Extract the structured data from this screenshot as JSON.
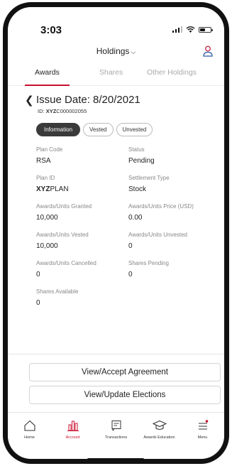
{
  "status_bar": {
    "time": "3:03"
  },
  "header": {
    "title": "Holdings"
  },
  "tabs": [
    {
      "label": "Awards",
      "active": true
    },
    {
      "label": "Shares",
      "active": false
    },
    {
      "label": "Other Holdings",
      "active": false
    }
  ],
  "award": {
    "title": "Issue Date: 8/20/2021",
    "id_label": "ID:",
    "id_bold": "XYZ",
    "id_rest": "C000002055"
  },
  "pills": [
    {
      "label": "Information",
      "selected": true
    },
    {
      "label": "Vested",
      "selected": false
    },
    {
      "label": "Unvested",
      "selected": false
    }
  ],
  "fields": [
    {
      "label": "Plan Code",
      "value": "RSA"
    },
    {
      "label": "Status",
      "value": "Pending"
    },
    {
      "label": "Plan ID",
      "value_bold": "XYZ",
      "value": "PLAN"
    },
    {
      "label": "Settlement Type",
      "value": "Stock"
    },
    {
      "label": "Awards/Units Granted",
      "value": "10,000"
    },
    {
      "label": "Awards/Units Price (USD)",
      "value": "0.00"
    },
    {
      "label": "Awards/Units Vested",
      "value": "10,000"
    },
    {
      "label": "Awards/Units Unvested",
      "value": "0"
    },
    {
      "label": "Awards/Units Cancelled",
      "value": "0"
    },
    {
      "label": "Shares Pending",
      "value": "0"
    },
    {
      "label": "Shares Available",
      "value": "0"
    }
  ],
  "actions": {
    "agreement": "View/Accept Agreement",
    "elections": "View/Update Elections"
  },
  "bottom_nav": [
    {
      "label": "Home",
      "icon": "home-icon",
      "active": false
    },
    {
      "label": "Account",
      "icon": "bar-chart-icon",
      "active": true
    },
    {
      "label": "Transactions",
      "icon": "receipt-icon",
      "active": false
    },
    {
      "label": "Awards Education",
      "icon": "graduation-cap-icon",
      "active": false
    },
    {
      "label": "Menu",
      "icon": "menu-icon",
      "active": false,
      "badge": true
    }
  ],
  "colors": {
    "accent": "#c8102e",
    "selected_pill": "#3a3a3a"
  }
}
